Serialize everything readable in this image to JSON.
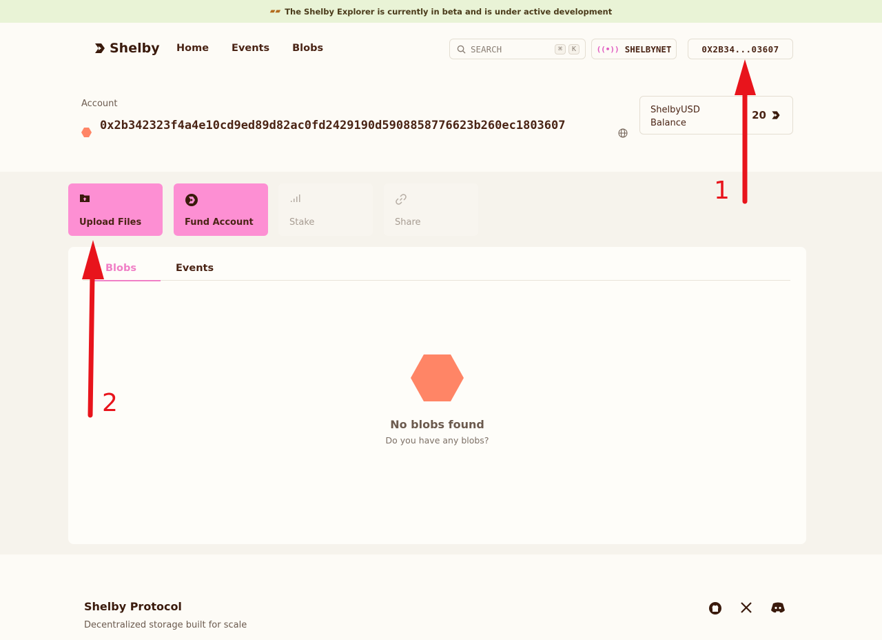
{
  "banner": {
    "text": "The Shelby Explorer is currently in beta and is under active development"
  },
  "header": {
    "logo": "Shelby",
    "nav": [
      "Home",
      "Events",
      "Blobs"
    ],
    "search": {
      "placeholder": "SEARCH",
      "shortcut_mod": "⌘",
      "shortcut_key": "K"
    },
    "network": "SHELBYNET",
    "wallet": "0X2B34...03607"
  },
  "account": {
    "label": "Account",
    "address": "0x2b342323f4a4e10cd9ed89d82ac0fd2429190d5908858776623b260ec1803607",
    "balance_label": "ShelbyUSD Balance",
    "balance_value": "20"
  },
  "actions": [
    {
      "label": "Upload Files",
      "icon": "folder-upload-icon",
      "enabled": true
    },
    {
      "label": "Fund Account",
      "icon": "shelby-logo-icon",
      "enabled": true
    },
    {
      "label": "Stake",
      "icon": "signal-bars-icon",
      "enabled": false
    },
    {
      "label": "Share",
      "icon": "link-icon",
      "enabled": false
    }
  ],
  "tabs": {
    "items": [
      "Blobs",
      "Events"
    ],
    "active": "Blobs"
  },
  "empty_state": {
    "title": "No blobs found",
    "subtitle": "Do you have any blobs?"
  },
  "footer": {
    "title": "Shelby Protocol",
    "subtitle": "Decentralized storage built for scale"
  },
  "annotations": {
    "one": "1",
    "two": "2"
  },
  "colors": {
    "accent_pink": "#fd8fd3",
    "hex_orange": "#ff8566",
    "annotation_red": "#e8141c"
  }
}
